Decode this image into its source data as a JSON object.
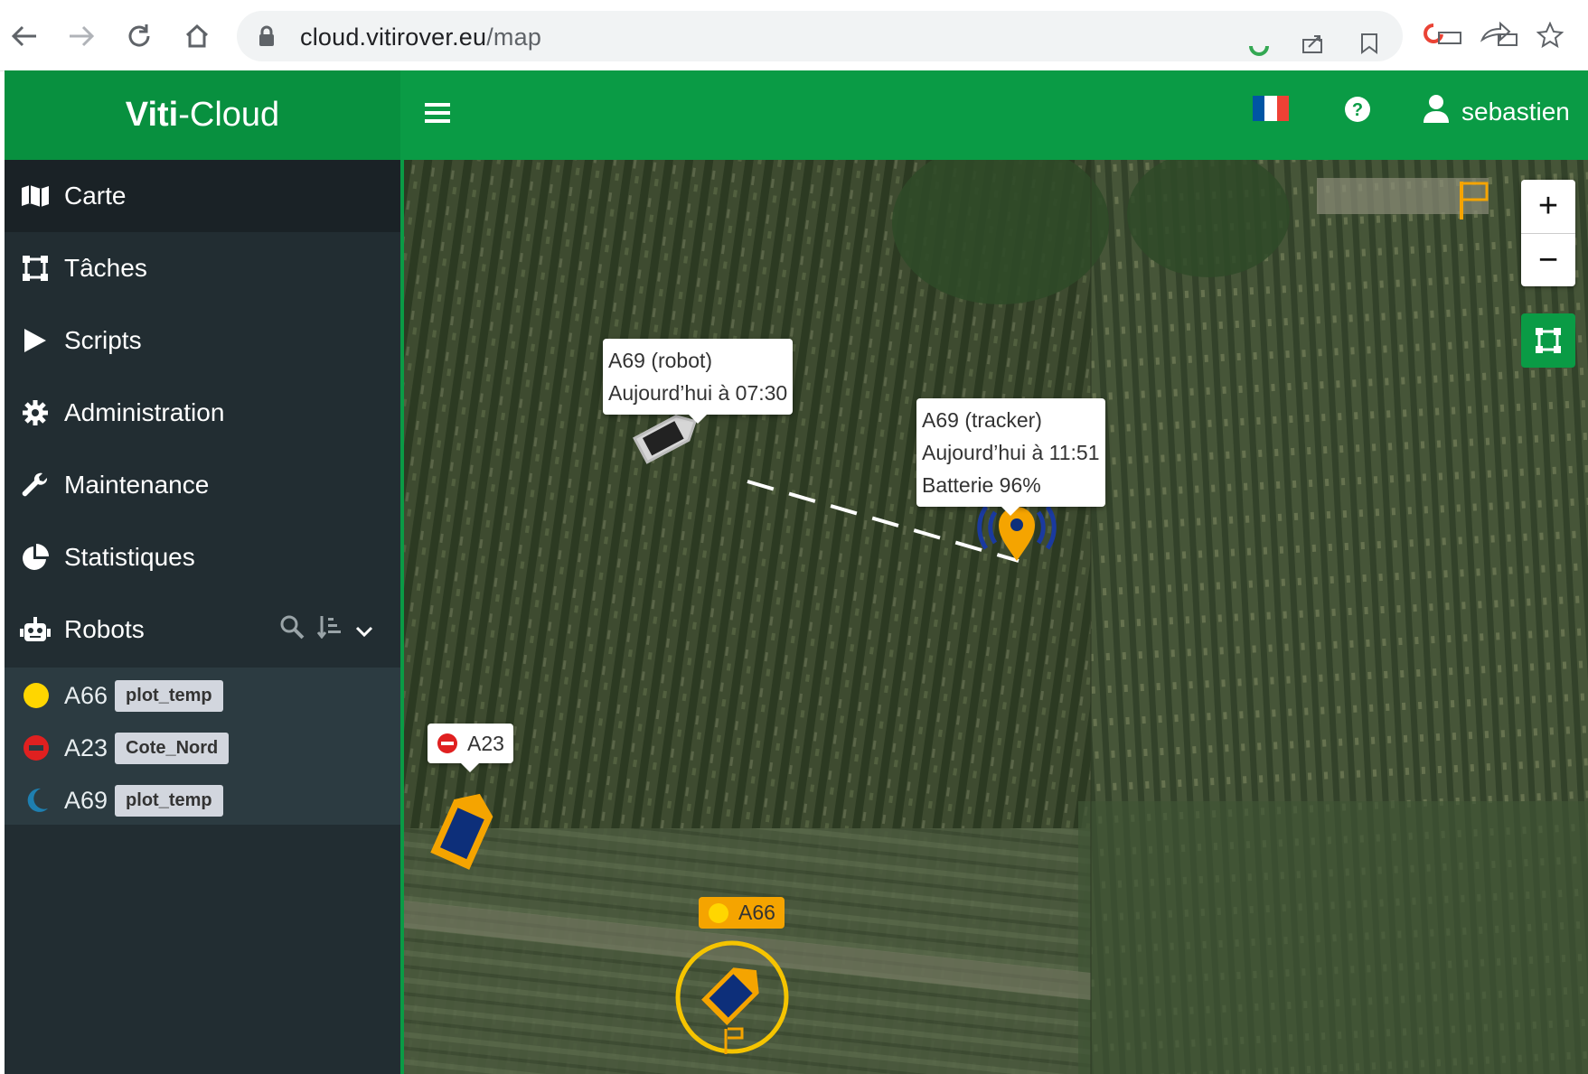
{
  "browser": {
    "url_host": "cloud.vitirover.eu",
    "url_path": "/map"
  },
  "header": {
    "brand_part1": "Viti",
    "brand_part2": "-Cloud",
    "username": "sebastien",
    "flag_colors": [
      "#0055A4",
      "#FFFFFF",
      "#EF4135"
    ]
  },
  "sidebar": {
    "items": [
      {
        "label": "Carte",
        "icon": "map-icon"
      },
      {
        "label": "Tâches",
        "icon": "vector-square-icon"
      },
      {
        "label": "Scripts",
        "icon": "play-icon"
      },
      {
        "label": "Administration",
        "icon": "gear-icon"
      },
      {
        "label": "Maintenance",
        "icon": "wrench-icon"
      },
      {
        "label": "Statistiques",
        "icon": "pie-chart-icon"
      },
      {
        "label": "Robots",
        "icon": "robot-icon"
      }
    ],
    "robots": [
      {
        "name": "A66",
        "tag": "plot_temp",
        "status": "yellow-circle",
        "color": "#FFD600"
      },
      {
        "name": "A23",
        "tag": "Cote_Nord",
        "status": "no-entry",
        "color": "#E02020"
      },
      {
        "name": "A69",
        "tag": "plot_temp",
        "status": "moon",
        "color": "#1E7FB0"
      }
    ]
  },
  "map": {
    "popup_robot": {
      "line1": "A69 (robot)",
      "line2": "Aujourd’hui à 07:30"
    },
    "popup_tracker": {
      "line1": "A69 (tracker)",
      "line2": "Aujourd’hui à 11:51",
      "line3": "Batterie 96%"
    },
    "label_a23": "A23",
    "label_a66": "A66",
    "zoom_in": "+",
    "zoom_out": "−",
    "accent_orange": "#F5A400",
    "robot_blue": "#0D2F7A"
  }
}
